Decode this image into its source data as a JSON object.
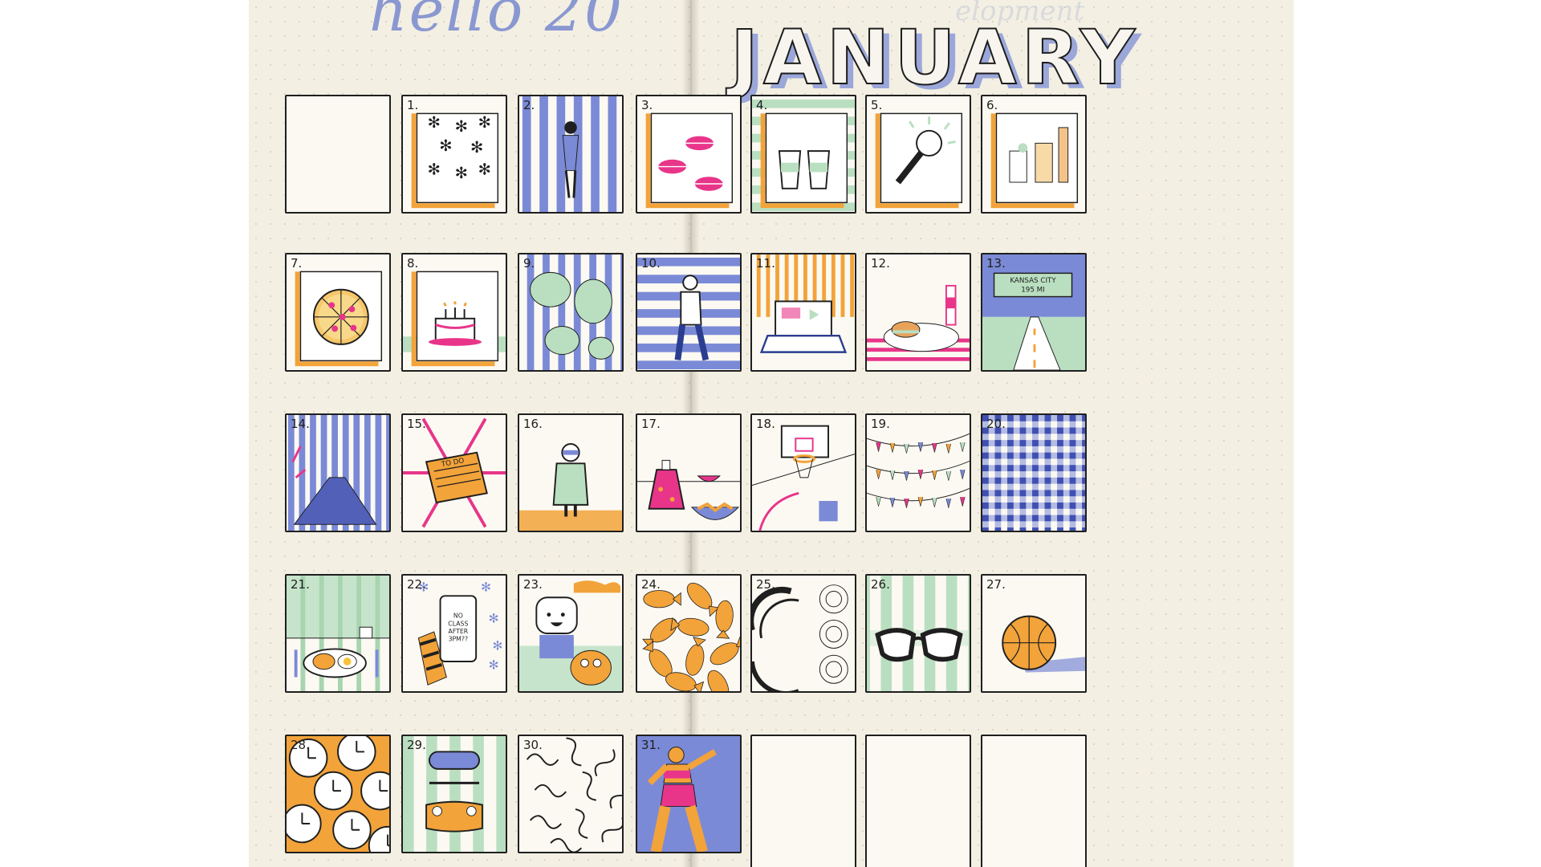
{
  "header": {
    "greeting": "hello 20",
    "greeting_year": "",
    "month": "JANUARY",
    "ghost_text": "elopment"
  },
  "palette": {
    "blue": "#7b8ad6",
    "orange": "#f2a33a",
    "green": "#b9dfc0",
    "pink": "#e8358a",
    "ink": "#1f1f1f",
    "paper": "#f3efe3"
  },
  "days": [
    {
      "label": "1.",
      "icon": "snowflakes-icon"
    },
    {
      "label": "2.",
      "icon": "figure-on-stripes-icon"
    },
    {
      "label": "3.",
      "icon": "lips-icon"
    },
    {
      "label": "4.",
      "icon": "coffee-cups-icon"
    },
    {
      "label": "5.",
      "icon": "microphone-icon"
    },
    {
      "label": "6.",
      "icon": "drinks-icon"
    },
    {
      "label": "7.",
      "icon": "pizza-icon"
    },
    {
      "label": "8.",
      "icon": "birthday-cake-icon"
    },
    {
      "label": "9.",
      "icon": "monstera-leaves-icon"
    },
    {
      "label": "10.",
      "icon": "walking-person-icon"
    },
    {
      "label": "11.",
      "icon": "laptop-icon"
    },
    {
      "label": "12.",
      "icon": "burger-plate-icon"
    },
    {
      "label": "13.",
      "icon": "road-sign-icon"
    },
    {
      "label": "14.",
      "icon": "hallway-icon"
    },
    {
      "label": "15.",
      "icon": "todo-list-icon"
    },
    {
      "label": "16.",
      "icon": "person-in-coat-icon"
    },
    {
      "label": "17.",
      "icon": "dress-and-bowls-icon"
    },
    {
      "label": "18.",
      "icon": "basketball-hoop-icon"
    },
    {
      "label": "19.",
      "icon": "bunting-icon"
    },
    {
      "label": "20.",
      "icon": "gingham-icon"
    },
    {
      "label": "21.",
      "icon": "breakfast-icon"
    },
    {
      "label": "22.",
      "icon": "phone-message-icon"
    },
    {
      "label": "23.",
      "icon": "cartoon-characters-icon"
    },
    {
      "label": "24.",
      "icon": "goldfish-crackers-icon"
    },
    {
      "label": "25.",
      "icon": "abstract-circles-icon"
    },
    {
      "label": "26.",
      "icon": "glasses-icon"
    },
    {
      "label": "27.",
      "icon": "basketball-icon"
    },
    {
      "label": "28.",
      "icon": "clocks-icon"
    },
    {
      "label": "29.",
      "icon": "skateboard-icon"
    },
    {
      "label": "30.",
      "icon": "squiggles-icon"
    },
    {
      "label": "31.",
      "icon": "swimmer-icon"
    }
  ],
  "phone_text": "NO CLASS AFTER 3PM??",
  "road_sign_text": "KANSAS CITY 195 MI",
  "todo_text": "TO DO"
}
